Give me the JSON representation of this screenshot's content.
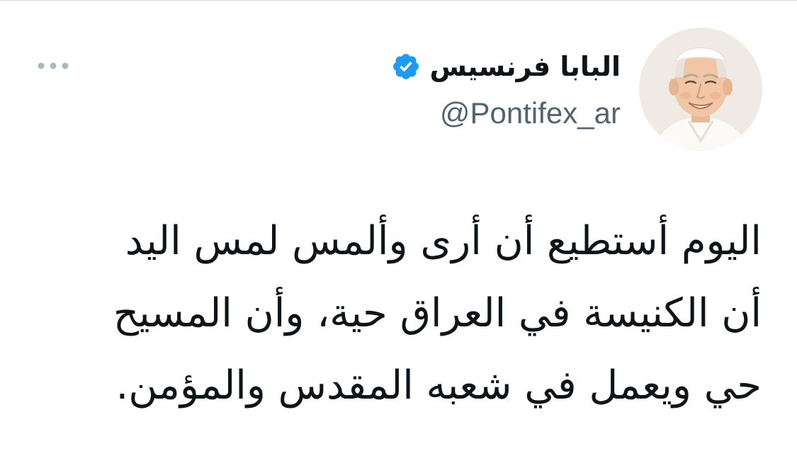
{
  "author": {
    "display_name": "البابا فرنسيس",
    "handle": "@Pontifex_ar",
    "verified": true,
    "avatar_icon": "avatar-portrait"
  },
  "actions": {
    "more_icon": "more-horizontal-icon"
  },
  "tweet": {
    "lines": [
      "اليوم أستطيع أن أرى وألمس لمس اليد",
      "أن الكنيسة في العراق حية، وأن المسيح",
      "حي ويعمل في شعبه المقدس والمؤمن."
    ]
  },
  "colors": {
    "text_primary": "#0f1419",
    "text_secondary": "#536471",
    "verified_blue": "#1d9bf0",
    "more_icon_gray": "#aab8c2",
    "divider": "#cfd9de"
  }
}
